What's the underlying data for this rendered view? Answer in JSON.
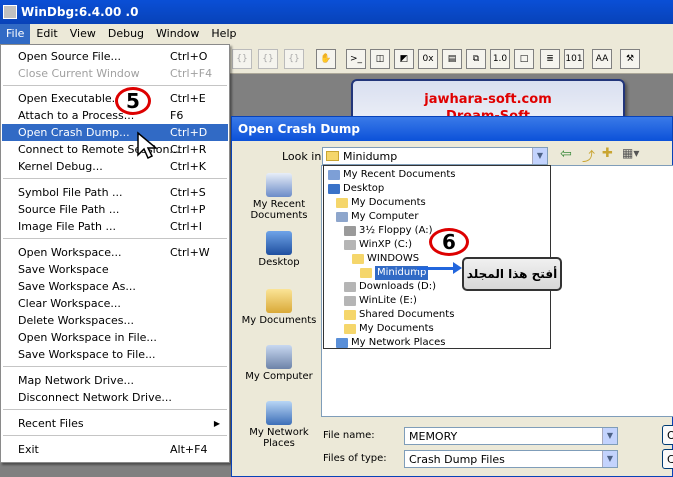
{
  "window": {
    "title": "WinDbg:6.4.00  .0"
  },
  "menubar": [
    "File",
    "Edit",
    "View",
    "Debug",
    "Window",
    "Help"
  ],
  "file_menu": [
    {
      "label": "Open Source File...",
      "shortcut": "Ctrl+O",
      "state": "normal"
    },
    {
      "label": "Close Current Window",
      "shortcut": "Ctrl+F4",
      "state": "disabled"
    },
    {
      "label": "Open Executable...",
      "shortcut": "Ctrl+E",
      "state": "normal"
    },
    {
      "label": "Attach to a Process...",
      "shortcut": "F6",
      "state": "normal"
    },
    {
      "label": "Open Crash Dump...",
      "shortcut": "Ctrl+D",
      "state": "highlighted"
    },
    {
      "label": "Connect to Remote Session...",
      "shortcut": "Ctrl+R",
      "state": "normal"
    },
    {
      "label": "Kernel Debug...",
      "shortcut": "Ctrl+K",
      "state": "normal"
    },
    {
      "label": "Symbol File Path ...",
      "shortcut": "Ctrl+S",
      "state": "normal"
    },
    {
      "label": "Source File Path ...",
      "shortcut": "Ctrl+P",
      "state": "normal"
    },
    {
      "label": "Image File Path ...",
      "shortcut": "Ctrl+I",
      "state": "normal"
    },
    {
      "label": "Open Workspace...",
      "shortcut": "Ctrl+W",
      "state": "normal"
    },
    {
      "label": "Save Workspace",
      "shortcut": "",
      "state": "normal"
    },
    {
      "label": "Save Workspace As...",
      "shortcut": "",
      "state": "normal"
    },
    {
      "label": "Clear Workspace...",
      "shortcut": "",
      "state": "normal"
    },
    {
      "label": "Delete Workspaces...",
      "shortcut": "",
      "state": "normal"
    },
    {
      "label": "Open Workspace in File...",
      "shortcut": "",
      "state": "normal"
    },
    {
      "label": "Save Workspace to File...",
      "shortcut": "",
      "state": "normal"
    },
    {
      "label": "Map Network Drive...",
      "shortcut": "",
      "state": "normal"
    },
    {
      "label": "Disconnect Network Drive...",
      "shortcut": "",
      "state": "normal"
    },
    {
      "label": "Recent Files",
      "shortcut": "",
      "state": "submenu"
    },
    {
      "label": "Exit",
      "shortcut": "Alt+F4",
      "state": "normal"
    }
  ],
  "banner": {
    "line1": "jawhara-soft.com",
    "line2": "Dream-Soft"
  },
  "dialog": {
    "title": "Open Crash Dump",
    "look_in_label": "Look in:",
    "look_in_value": "Minidump",
    "places": [
      "My Recent Documents",
      "Desktop",
      "My Documents",
      "My Computer",
      "My Network Places"
    ],
    "tree": [
      {
        "label": "My Recent Documents",
        "indent": 0
      },
      {
        "label": "Desktop",
        "indent": 0
      },
      {
        "label": "My Documents",
        "indent": 1
      },
      {
        "label": "My Computer",
        "indent": 1
      },
      {
        "label": "3½ Floppy (A:)",
        "indent": 2
      },
      {
        "label": "WinXP (C:)",
        "indent": 2
      },
      {
        "label": "WINDOWS",
        "indent": 3
      },
      {
        "label": "Minidump",
        "indent": 4,
        "selected": true
      },
      {
        "label": "Downloads (D:)",
        "indent": 2
      },
      {
        "label": "WinLite (E:)",
        "indent": 2
      },
      {
        "label": "Shared Documents",
        "indent": 2
      },
      {
        "label": "My Documents",
        "indent": 2
      },
      {
        "label": "My Network Places",
        "indent": 1
      }
    ],
    "file_name_label": "File name:",
    "file_name_value": "MEMORY",
    "file_type_label": "Files of type:",
    "file_type_value": "Crash Dump Files",
    "open_button": "O",
    "cancel_button": "C"
  },
  "annotations": {
    "step5": "5",
    "step6": "6",
    "arabic_note": "أفتح هذا المجلد"
  },
  "colors": {
    "highlight": "#316ac5",
    "title_blue": "#0842b8",
    "annotation_red": "#dd0000"
  }
}
